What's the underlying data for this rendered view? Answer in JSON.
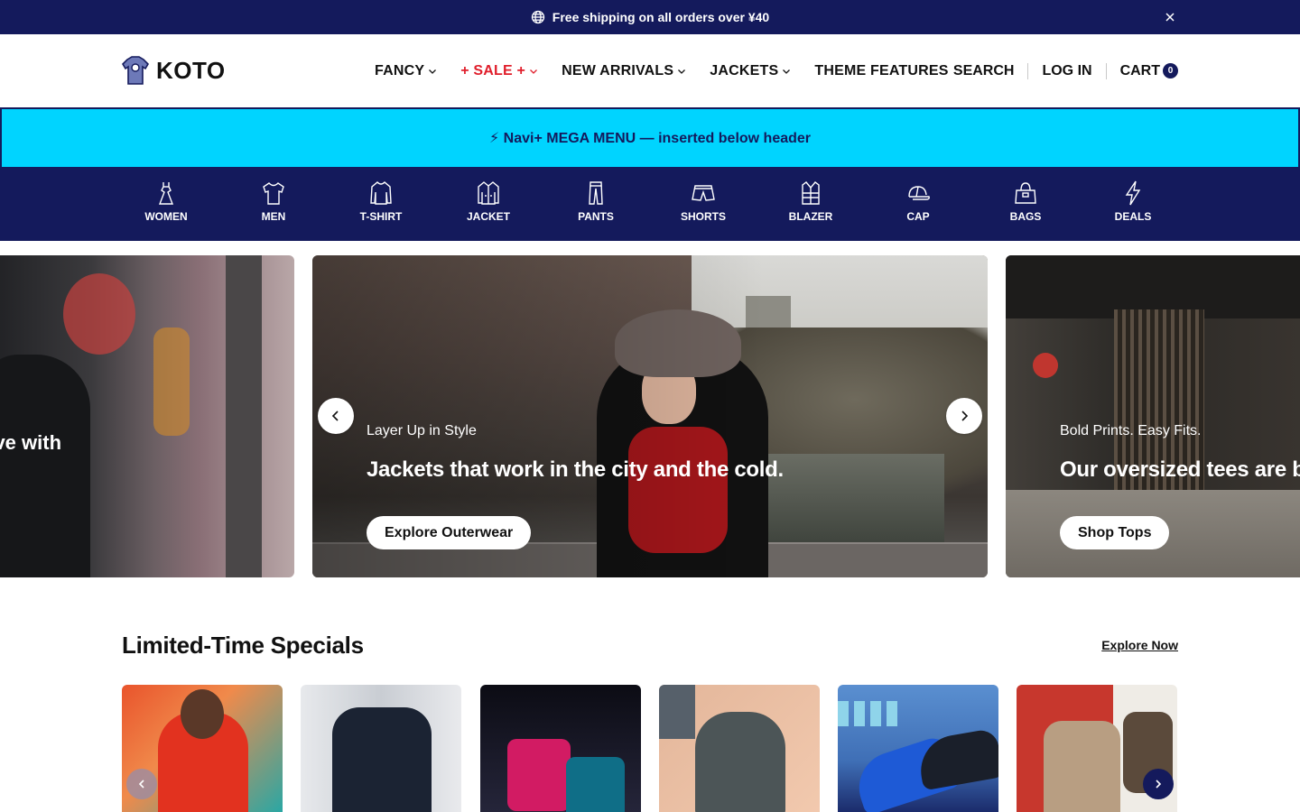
{
  "announcement": {
    "text": "Free shipping on all orders over ¥40",
    "icon": "globe-icon",
    "close_icon": "close-icon"
  },
  "header": {
    "logo_text": "KOTO",
    "nav": [
      {
        "label": "FANCY",
        "dropdown": true
      },
      {
        "label": "+ SALE +",
        "dropdown": true,
        "color": "#e01e2b"
      },
      {
        "label": "NEW ARRIVALS",
        "dropdown": true
      },
      {
        "label": "JACKETS",
        "dropdown": true
      },
      {
        "label": "THEME FEATURES",
        "dropdown": false
      }
    ],
    "actions": {
      "search": "SEARCH",
      "login": "LOG IN",
      "cart": "CART",
      "cart_count": "0"
    }
  },
  "mega_banner": {
    "text": "⚡ Navi+ MEGA MENU — inserted below header",
    "background": "#00d4ff"
  },
  "categories": [
    {
      "label": "WOMEN",
      "icon": "dress-icon"
    },
    {
      "label": "MEN",
      "icon": "shirt-icon"
    },
    {
      "label": "T-SHIRT",
      "icon": "sweater-icon"
    },
    {
      "label": "JACKET",
      "icon": "jacket-icon"
    },
    {
      "label": "PANTS",
      "icon": "pants-icon"
    },
    {
      "label": "SHORTS",
      "icon": "shorts-icon"
    },
    {
      "label": "BLAZER",
      "icon": "vest-icon"
    },
    {
      "label": "CAP",
      "icon": "cap-icon"
    },
    {
      "label": "BAGS",
      "icon": "bag-icon"
    },
    {
      "label": "DEALS",
      "icon": "lightning-icon"
    }
  ],
  "hero": {
    "prev_slide_text": "ove with",
    "active": {
      "eyebrow": "Layer Up in Style",
      "headline": "Jackets that work in the city and the cold.",
      "cta": "Explore Outerwear"
    },
    "next": {
      "eyebrow": "Bold Prints. Easy Fits.",
      "headline": "Our oversized tees are bac",
      "cta": "Shop Tops"
    }
  },
  "specials": {
    "title": "Limited-Time Specials",
    "link": "Explore Now",
    "cards": [
      "red-hoodie",
      "leather-jacket",
      "handbags",
      "grey-hoodie",
      "sneakers",
      "cardigan"
    ]
  },
  "colors": {
    "brand_navy": "#141a5c",
    "sale_red": "#e01e2b",
    "mega_cyan": "#00d4ff"
  }
}
